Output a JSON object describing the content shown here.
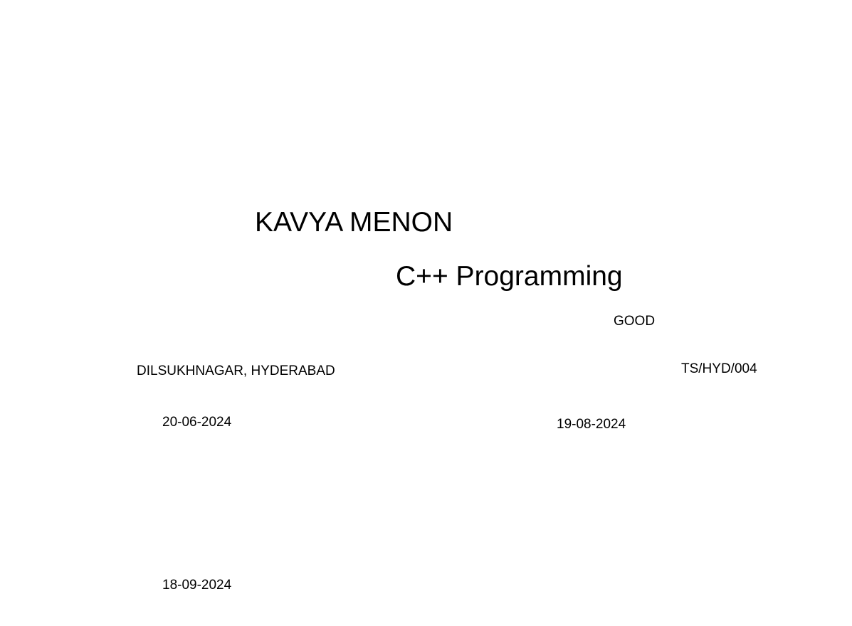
{
  "certificate": {
    "student_name": "KAVYA MENON",
    "course": "C++ Programming",
    "grade": "GOOD",
    "center": "DILSUKHNAGAR, HYDERABAD",
    "certificate_no": "TS/HYD/004",
    "start_date": "20-06-2024",
    "end_date": "19-08-2024",
    "issue_date": "18-09-2024"
  }
}
